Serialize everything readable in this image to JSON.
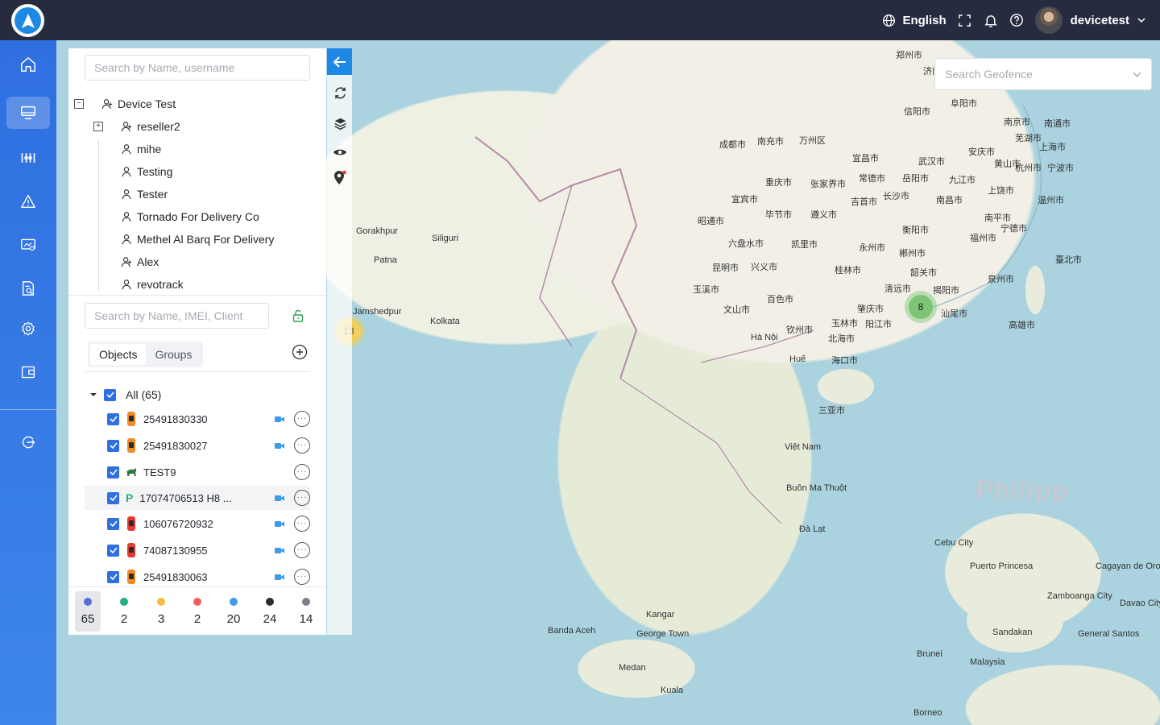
{
  "header": {
    "language": "English",
    "username": "devicetest"
  },
  "tree": {
    "search_placeholder": "Search by Name, username",
    "root": "Device Test",
    "reseller": "reseller2",
    "users": [
      "mihe",
      "Testing",
      "Tester",
      "Tornado For Delivery Co",
      "Methel Al Barq For Delivery",
      "Alex",
      "revotrack"
    ]
  },
  "objects": {
    "search_placeholder": "Search by Name, IMEI, Client",
    "tabs": [
      "Objects",
      "Groups"
    ],
    "all_label": "All (65)",
    "items": [
      {
        "name": "25491830330",
        "icon": "car-orange-icon"
      },
      {
        "name": "25491830027",
        "icon": "car-orange-icon"
      },
      {
        "name": "TEST9",
        "icon": "animal-icon"
      },
      {
        "name": "17074706513 H8 ...",
        "icon": "parking-icon"
      },
      {
        "name": "106076720932",
        "icon": "car-red-icon"
      },
      {
        "name": "74087130955",
        "icon": "car-red-icon"
      },
      {
        "name": "25491830063",
        "icon": "car-orange-icon"
      }
    ]
  },
  "status_counts": [
    {
      "count": "65",
      "color": "#5b6bd6"
    },
    {
      "count": "2",
      "color": "#22b07d"
    },
    {
      "count": "3",
      "color": "#f5b942"
    },
    {
      "count": "2",
      "color": "#f06060"
    },
    {
      "count": "20",
      "color": "#3d9be9"
    },
    {
      "count": "24",
      "color": "#2a2a33"
    },
    {
      "count": "14",
      "color": "#7a7f8c"
    }
  ],
  "geofence": {
    "placeholder": "Search Geofence"
  },
  "map": {
    "clusters": [
      "8",
      "13"
    ],
    "labels": [
      "郑州市",
      "济南市",
      "信阳市",
      "阜阳市",
      "南京市",
      "南通市",
      "上海市",
      "武汉市",
      "安庆市",
      "芜湖市",
      "杭州市",
      "宁波市",
      "成都市",
      "南充市",
      "万州区",
      "宜昌市",
      "重庆市",
      "张家界市",
      "常德市",
      "岳阳市",
      "九江市",
      "黄山市",
      "长沙市",
      "南昌市",
      "上饶市",
      "温州市",
      "宜宾市",
      "毕节市",
      "遵义市",
      "吉首市",
      "昭通市",
      "六盘水市",
      "凯里市",
      "衡阳市",
      "南平市",
      "宁德市",
      "永州市",
      "郴州市",
      "昆明市",
      "兴义市",
      "桂林市",
      "韶关市",
      "福州市",
      "泉州市",
      "臺北市",
      "玉溪市",
      "文山市",
      "百色市",
      "清远市",
      "揭阳市",
      "汕尾市",
      "肇庆市",
      "玉林市",
      "阳江市",
      "钦州市",
      "北海市",
      "海口市",
      "三亚市",
      "高雄市",
      "Gorakhpur",
      "Siliguri",
      "Patna",
      "Jamshedpur",
      "Kolkata",
      "Hà Nội",
      "Huế",
      "Việt Nam",
      "Buôn Ma Thuột",
      "Đà Lạt",
      "Cebu City",
      "Puerto Princesa",
      "Cagayan de Oro",
      "Zamboanga City",
      "Davao City",
      "Kangar",
      "George Town",
      "Banda Aceh",
      "Medan",
      "Kuala",
      "Sandakan",
      "General Santos",
      "Brunei",
      "Malaysia",
      "Borneo"
    ],
    "big_label": "Philipp"
  }
}
